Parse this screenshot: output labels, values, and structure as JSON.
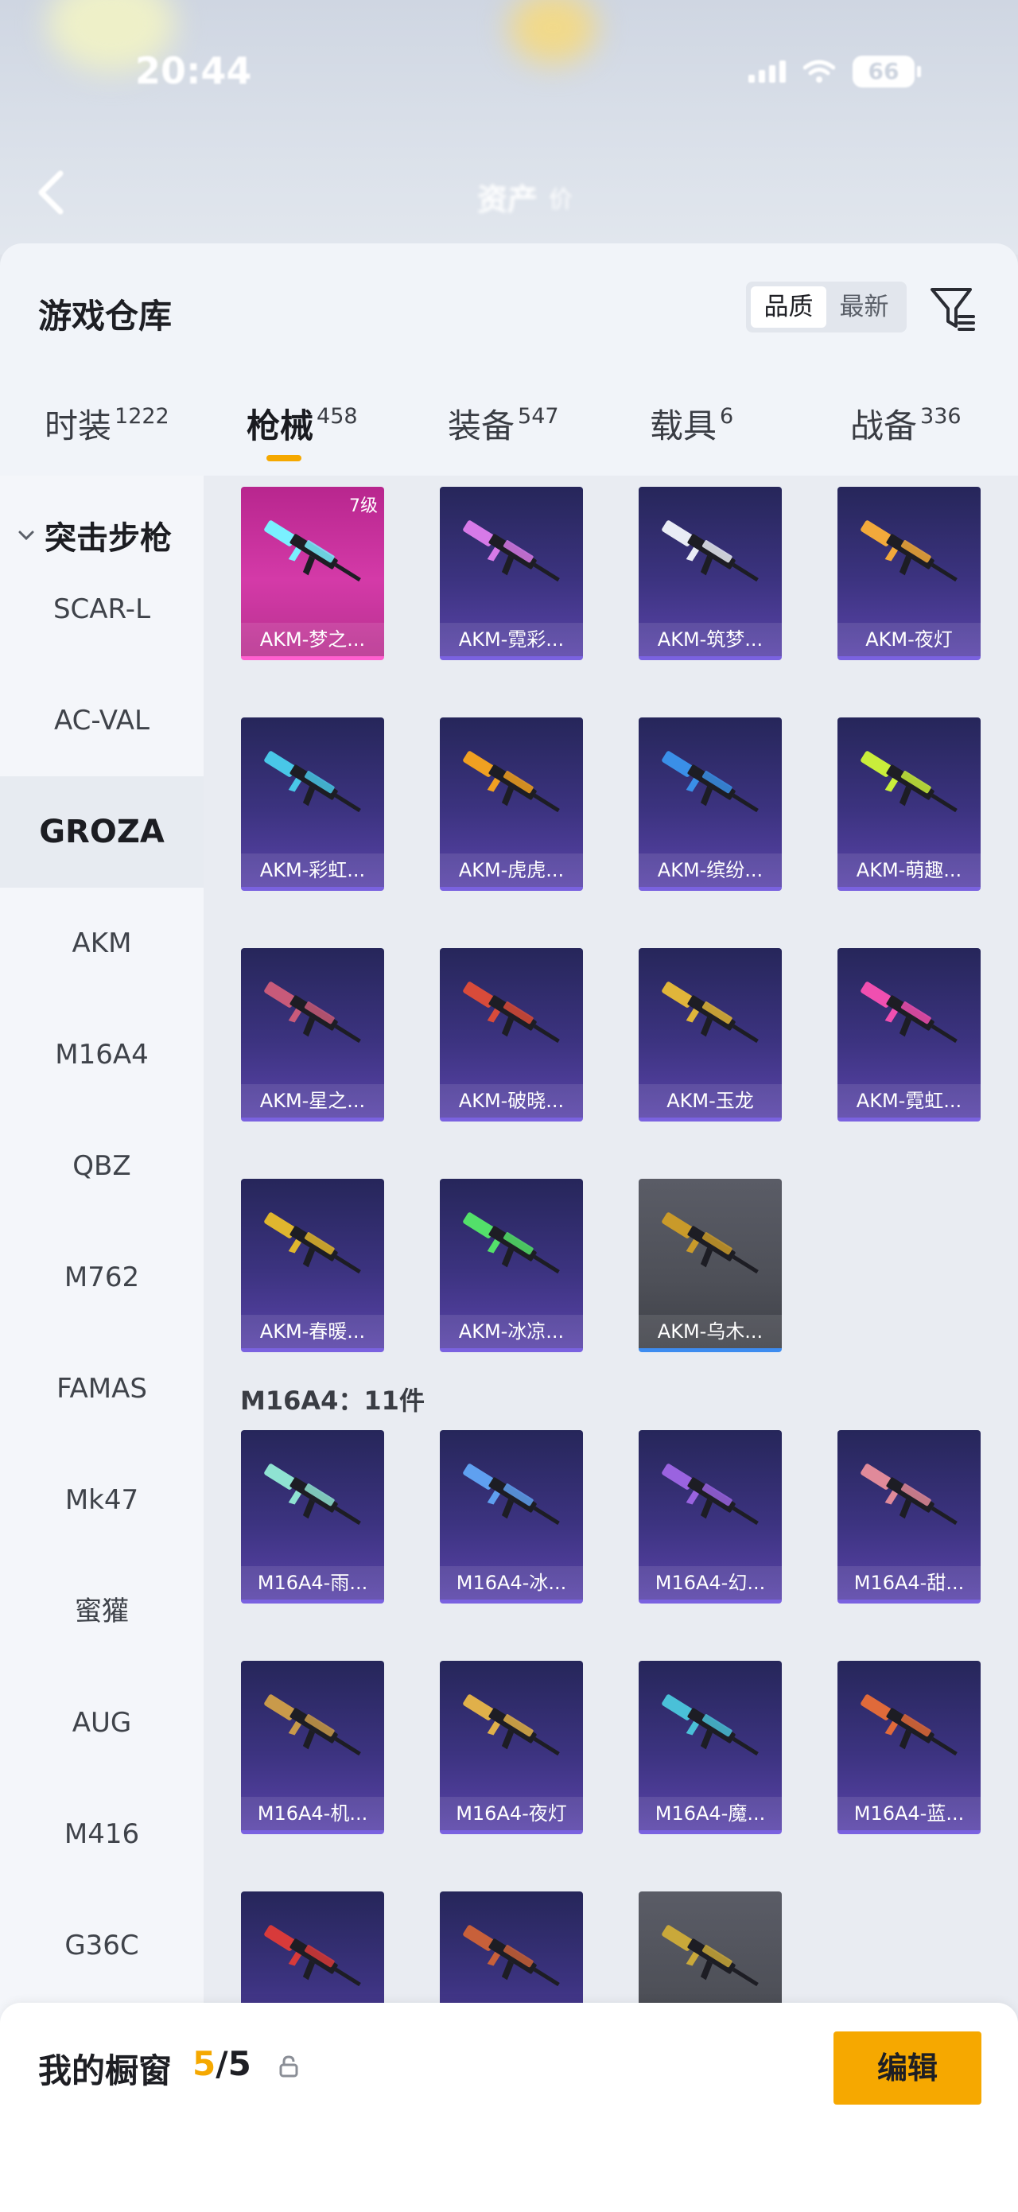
{
  "status_bar": {
    "time": "20:44",
    "battery": "66"
  },
  "background_header": {
    "label_a": "资产",
    "label_b": "价"
  },
  "sheet": {
    "title": "游戏仓库",
    "sort_options": [
      "品质",
      "最新"
    ],
    "sort_active": "品质"
  },
  "tabs": [
    {
      "label": "时装",
      "count": "1222"
    },
    {
      "label": "枪械",
      "count": "458"
    },
    {
      "label": "装备",
      "count": "547"
    },
    {
      "label": "载具",
      "count": "6"
    },
    {
      "label": "战备",
      "count": "336"
    }
  ],
  "active_tab": "枪械",
  "categories": {
    "group": "突击步枪",
    "items": [
      "SCAR-L",
      "AC-VAL",
      "GROZA",
      "AKM",
      "M16A4",
      "QBZ",
      "M762",
      "FAMAS",
      "Mk47",
      "蜜獾",
      "AUG",
      "M416",
      "G36C"
    ],
    "selected": "GROZA"
  },
  "akm_items": [
    {
      "label": "AKM-梦之...",
      "level": "7级",
      "style": "pink",
      "accent": "#7af0ff"
    },
    {
      "label": "AKM-霓彩...",
      "style": "purple",
      "accent": "#d77ae8"
    },
    {
      "label": "AKM-筑梦...",
      "style": "purple",
      "accent": "#e9ecf5"
    },
    {
      "label": "AKM-夜灯",
      "style": "purple",
      "accent": "#f2a93b"
    },
    {
      "label": "AKM-彩虹...",
      "style": "purple",
      "accent": "#49c7e8"
    },
    {
      "label": "AKM-虎虎...",
      "style": "purple",
      "accent": "#f0a021"
    },
    {
      "label": "AKM-缤纷...",
      "style": "purple",
      "accent": "#3a8fe8"
    },
    {
      "label": "AKM-萌趣...",
      "style": "purple",
      "accent": "#c9ee3b"
    },
    {
      "label": "AKM-星之...",
      "style": "purple",
      "accent": "#c85a7a"
    },
    {
      "label": "AKM-破晓...",
      "style": "purple",
      "accent": "#d84b3a"
    },
    {
      "label": "AKM-玉龙",
      "style": "purple",
      "accent": "#e0b53a"
    },
    {
      "label": "AKM-霓虹...",
      "style": "purple",
      "accent": "#f04fb0"
    },
    {
      "label": "AKM-春暖...",
      "style": "purple",
      "accent": "#e0b62e"
    },
    {
      "label": "AKM-冰凉...",
      "style": "purple",
      "accent": "#53e06a"
    },
    {
      "label": "AKM-乌木...",
      "style": "grey",
      "accent": "#c99a2a"
    }
  ],
  "m16_section": {
    "title": "M16A4：11件"
  },
  "m16_items": [
    {
      "label": "M16A4-雨...",
      "style": "purple",
      "accent": "#8fe3d2"
    },
    {
      "label": "M16A4-冰...",
      "style": "purple",
      "accent": "#5fa0f0"
    },
    {
      "label": "M16A4-幻...",
      "style": "purple",
      "accent": "#9a63e0"
    },
    {
      "label": "M16A4-甜...",
      "style": "purple",
      "accent": "#e08a9a"
    },
    {
      "label": "M16A4-机...",
      "style": "purple",
      "accent": "#c99a4a"
    },
    {
      "label": "M16A4-夜灯",
      "style": "purple",
      "accent": "#e0b04a"
    },
    {
      "label": "M16A4-魔...",
      "style": "purple",
      "accent": "#4ac0d8"
    },
    {
      "label": "M16A4-蓝...",
      "style": "purple",
      "accent": "#e06a3a"
    },
    {
      "label": "",
      "style": "purple",
      "accent": "#d83a3a"
    },
    {
      "label": "",
      "style": "purple",
      "accent": "#c8603a"
    },
    {
      "label": "",
      "style": "grey",
      "accent": "#c9a83a"
    }
  ],
  "showcase": {
    "label": "我的橱窗",
    "current": "5",
    "total": "/5",
    "edit_label": "编辑"
  },
  "colors": {
    "accent": "#f5a800",
    "card_purple": "#3c3380",
    "card_pink": "#d43aa8",
    "card_grey": "#4e5058"
  }
}
